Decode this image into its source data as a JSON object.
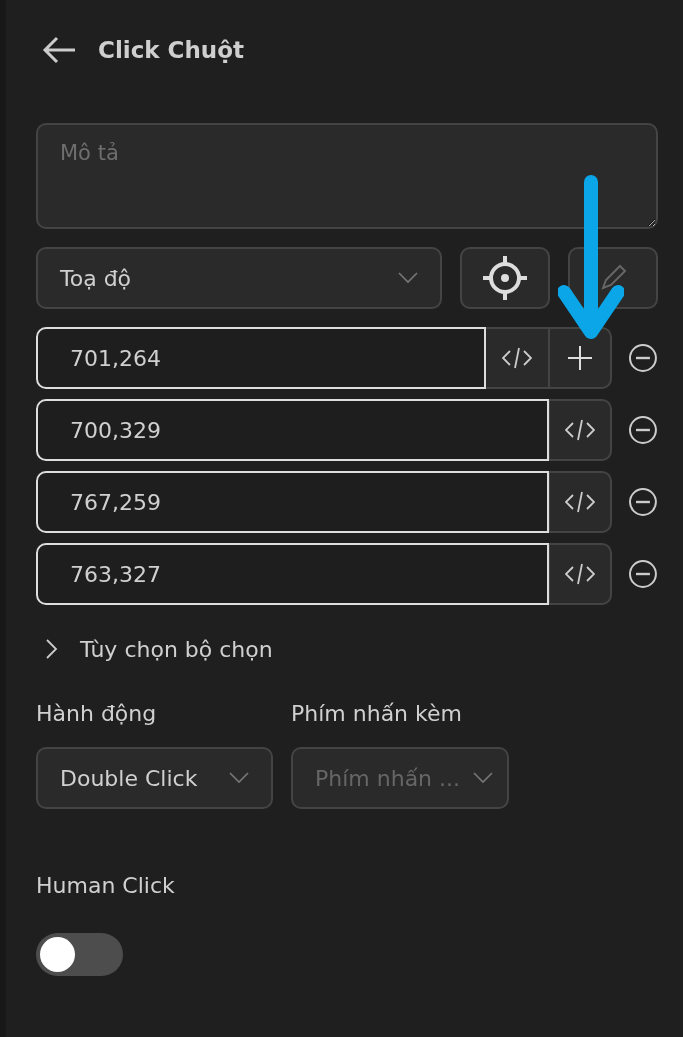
{
  "header": {
    "title": "Click Chuột"
  },
  "description": {
    "placeholder": "Mô tả"
  },
  "target_mode": {
    "value": "Toạ độ"
  },
  "points": [
    {
      "value": "701,264",
      "has_add": true
    },
    {
      "value": "700,329",
      "has_add": false
    },
    {
      "value": "767,259",
      "has_add": false
    },
    {
      "value": "763,327",
      "has_add": false
    }
  ],
  "selector_options": {
    "label": "Tùy chọn bộ chọn",
    "expanded": false
  },
  "action": {
    "label": "Hành động",
    "value": "Double Click"
  },
  "modifier": {
    "label": "Phím nhấn kèm",
    "placeholder": "Phím nhấn ..."
  },
  "human_click": {
    "label": "Human Click",
    "on": false
  }
}
